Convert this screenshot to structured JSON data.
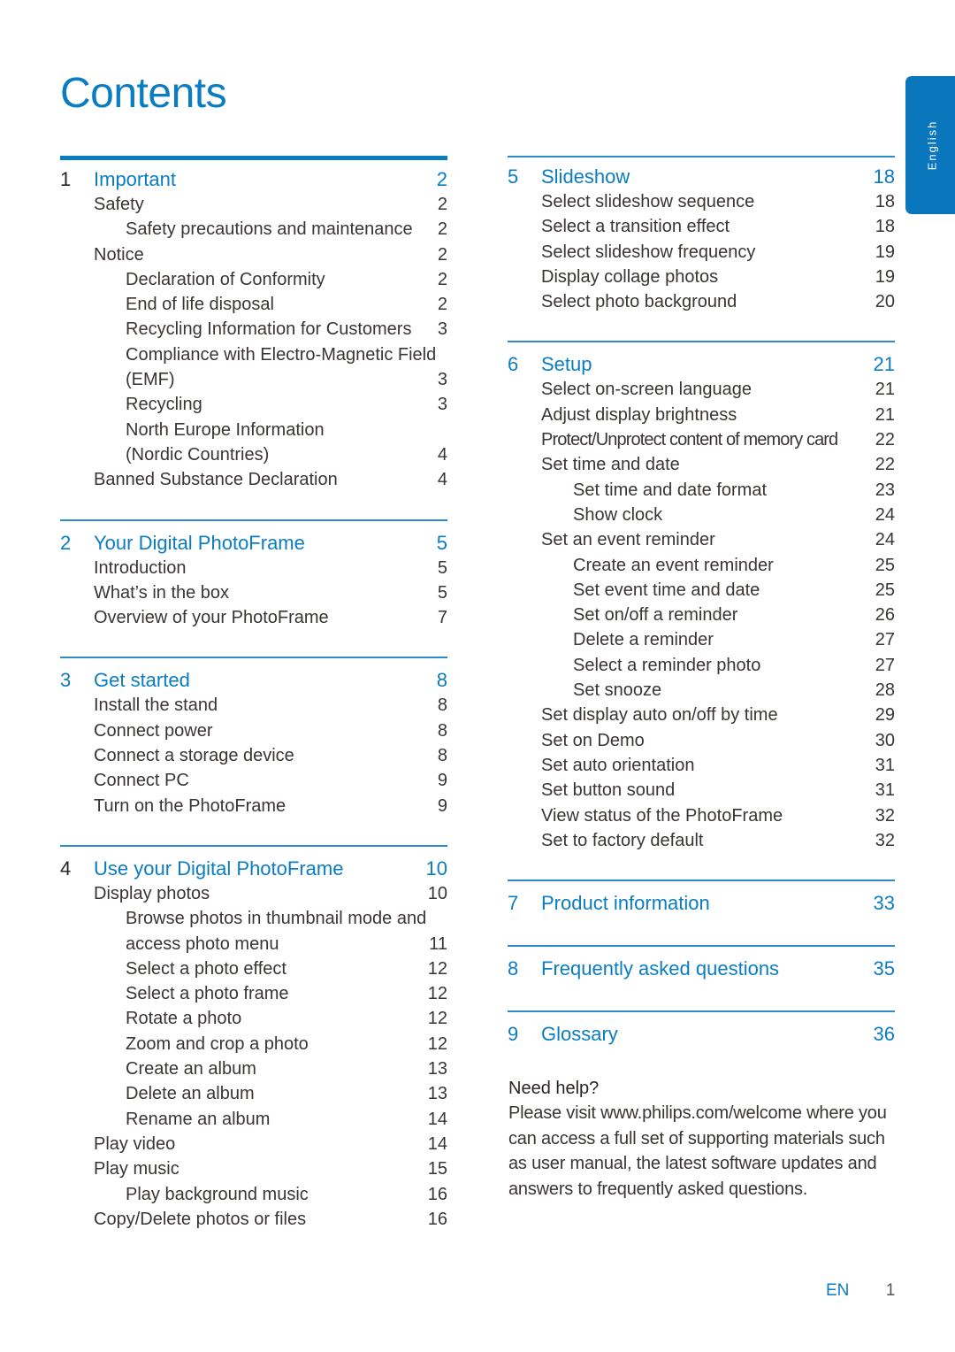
{
  "page": {
    "title": "Contents",
    "language_tab": "English",
    "footer_lang": "EN",
    "footer_page": "1"
  },
  "colors": {
    "accent": "#0a7dc2",
    "text": "#3a3433",
    "tab": "#0a77bd"
  },
  "toc_left": [
    {
      "num": "1",
      "title": "Important",
      "page": "2",
      "num_style": "dark",
      "rule": "thick",
      "entries": [
        {
          "text": "Safety",
          "page": "2",
          "level": 1
        },
        {
          "text": "Safety precautions and maintenance",
          "page": "2",
          "level": 2
        },
        {
          "text": "Notice",
          "page": "2",
          "level": 1
        },
        {
          "text": "Declaration of Conformity",
          "page": "2",
          "level": 2
        },
        {
          "text": "End of life disposal",
          "page": "2",
          "level": 2
        },
        {
          "text": "Recycling Information for Customers",
          "page": "3",
          "level": 2
        },
        {
          "text": "Compliance with Electro-Magnetic Field",
          "page": "",
          "level": 2
        },
        {
          "text": "(EMF)",
          "page": "3",
          "level": 2
        },
        {
          "text": "Recycling",
          "page": "3",
          "level": 2
        },
        {
          "text": "North Europe Information",
          "page": "",
          "level": 2
        },
        {
          "text": "(Nordic Countries)",
          "page": "4",
          "level": 2
        },
        {
          "text": "Banned Substance Declaration",
          "page": "4",
          "level": 1
        }
      ]
    },
    {
      "num": "2",
      "title": "Your Digital PhotoFrame",
      "page": "5",
      "num_style": "accent",
      "rule": "thin",
      "entries": [
        {
          "text": "Introduction",
          "page": "5",
          "level": 1
        },
        {
          "text": "What’s in the box",
          "page": "5",
          "level": 1
        },
        {
          "text": "Overview of your PhotoFrame",
          "page": "7",
          "level": 1
        }
      ]
    },
    {
      "num": "3",
      "title": "Get started",
      "page": "8",
      "num_style": "accent",
      "rule": "thin",
      "entries": [
        {
          "text": "Install the stand",
          "page": "8",
          "level": 1
        },
        {
          "text": "Connect power",
          "page": "8",
          "level": 1
        },
        {
          "text": "Connect a storage device",
          "page": "8",
          "level": 1
        },
        {
          "text": "Connect PC",
          "page": "9",
          "level": 1
        },
        {
          "text": "Turn on the PhotoFrame",
          "page": "9",
          "level": 1
        }
      ]
    },
    {
      "num": "4",
      "title": "Use your Digital PhotoFrame",
      "page": "10",
      "num_style": "dark",
      "rule": "thin",
      "entries": [
        {
          "text": "Display photos",
          "page": "10",
          "level": 1
        },
        {
          "text": "Browse photos in thumbnail mode and",
          "page": "",
          "level": 2
        },
        {
          "text": "access photo menu",
          "page": "11",
          "level": 2
        },
        {
          "text": "Select a photo effect",
          "page": "12",
          "level": 2
        },
        {
          "text": "Select a photo frame",
          "page": "12",
          "level": 2
        },
        {
          "text": "Rotate a photo",
          "page": "12",
          "level": 2
        },
        {
          "text": "Zoom and crop a photo",
          "page": "12",
          "level": 2
        },
        {
          "text": "Create an album",
          "page": "13",
          "level": 2
        },
        {
          "text": "Delete an album",
          "page": "13",
          "level": 2
        },
        {
          "text": "Rename an album",
          "page": "14",
          "level": 2
        },
        {
          "text": "Play video",
          "page": "14",
          "level": 1
        },
        {
          "text": "Play music",
          "page": "15",
          "level": 1
        },
        {
          "text": "Play background music",
          "page": "16",
          "level": 2
        },
        {
          "text": "Copy/Delete photos or files",
          "page": "16",
          "level": 1
        }
      ]
    }
  ],
  "toc_right": [
    {
      "num": "5",
      "title": "Slideshow",
      "page": "18",
      "num_style": "accent",
      "rule": "thin",
      "entries": [
        {
          "text": "Select slideshow sequence",
          "page": "18",
          "level": 1
        },
        {
          "text": "Select a transition effect",
          "page": "18",
          "level": 1
        },
        {
          "text": "Select slideshow frequency",
          "page": "19",
          "level": 1
        },
        {
          "text": "Display collage photos",
          "page": "19",
          "level": 1
        },
        {
          "text": "Select photo background",
          "page": "20",
          "level": 1
        }
      ]
    },
    {
      "num": "6",
      "title": "Setup",
      "page": "21",
      "num_style": "accent",
      "rule": "thin",
      "entries": [
        {
          "text": "Select on-screen language",
          "page": "21",
          "level": 1
        },
        {
          "text": "Adjust display brightness",
          "page": "21",
          "level": 1
        },
        {
          "text": "Protect/Unprotect content of memory card",
          "page": "22",
          "level": 1,
          "condensed": true
        },
        {
          "text": "Set time and date",
          "page": "22",
          "level": 1
        },
        {
          "text": "Set time and date format",
          "page": "23",
          "level": 2
        },
        {
          "text": "Show clock",
          "page": "24",
          "level": 2
        },
        {
          "text": "Set an event reminder",
          "page": "24",
          "level": 1
        },
        {
          "text": "Create an event reminder",
          "page": "25",
          "level": 2
        },
        {
          "text": "Set event time and date",
          "page": "25",
          "level": 2
        },
        {
          "text": "Set on/off a reminder",
          "page": "26",
          "level": 2
        },
        {
          "text": "Delete a reminder",
          "page": "27",
          "level": 2
        },
        {
          "text": "Select a reminder photo",
          "page": "27",
          "level": 2
        },
        {
          "text": "Set snooze",
          "page": "28",
          "level": 2
        },
        {
          "text": "Set display auto on/off by time",
          "page": "29",
          "level": 1
        },
        {
          "text": "Set on Demo",
          "page": "30",
          "level": 1
        },
        {
          "text": "Set auto orientation",
          "page": "31",
          "level": 1
        },
        {
          "text": "Set button sound",
          "page": "31",
          "level": 1
        },
        {
          "text": "View status of the PhotoFrame",
          "page": "32",
          "level": 1
        },
        {
          "text": "Set to factory default",
          "page": "32",
          "level": 1
        }
      ]
    },
    {
      "num": "7",
      "title": "Product information",
      "page": "33",
      "num_style": "accent",
      "rule": "thin",
      "entries": []
    },
    {
      "num": "8",
      "title": "Frequently asked questions",
      "page": "35",
      "num_style": "accent",
      "rule": "thin",
      "entries": []
    },
    {
      "num": "9",
      "title": "Glossary",
      "page": "36",
      "num_style": "accent",
      "rule": "thin",
      "entries": []
    }
  ],
  "help": {
    "heading": "Need help?",
    "body": "Please visit www.philips.com/welcome where you can access a full set of supporting materials such as user manual, the latest software updates and answers to frequently asked questions."
  }
}
